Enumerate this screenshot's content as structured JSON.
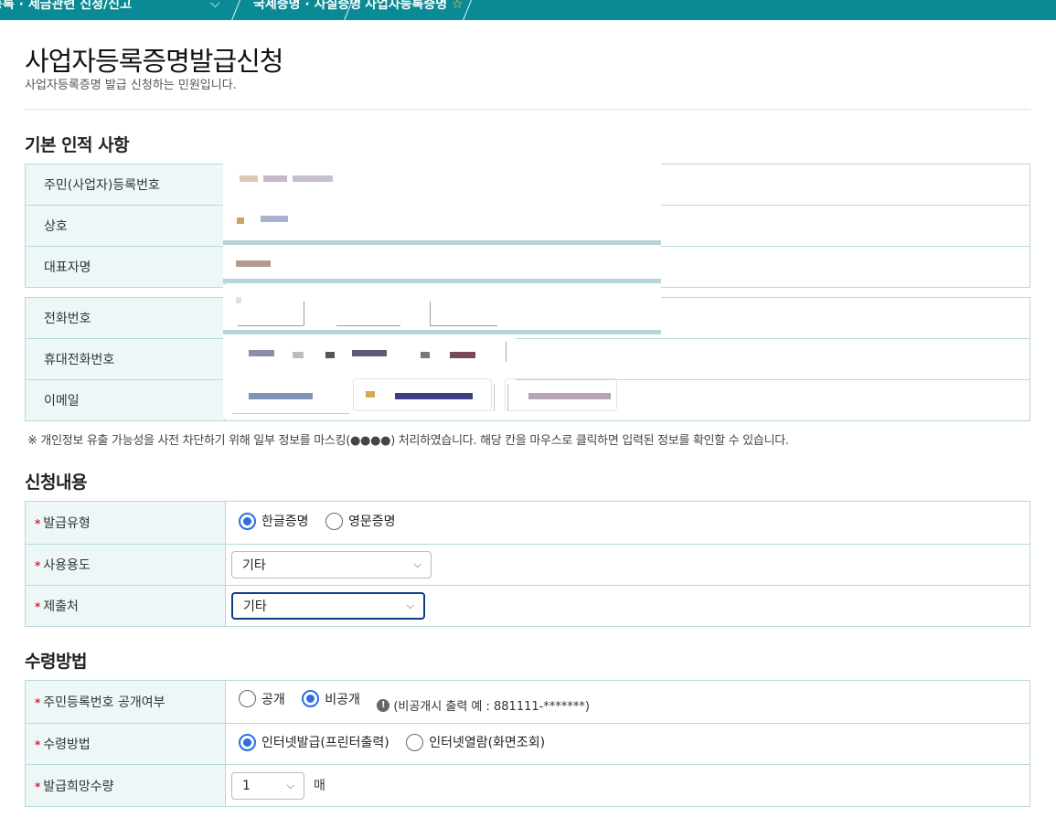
{
  "breadcrumb": {
    "item1": "등록 · 세금관련 신청/신고",
    "item2": "국세증명 · 사실증명",
    "item3": "사업자등록증명"
  },
  "page": {
    "title": "사업자등록증명발급신청",
    "subtitle": "사업자등록증명 발급 신청하는 민원입니다."
  },
  "basic_info": {
    "heading": "기본 인적 사항",
    "rows": [
      {
        "label": "주민(사업자)등록번호"
      },
      {
        "label": "상호"
      },
      {
        "label": "대표자명"
      }
    ],
    "contact_rows": [
      {
        "label": "전화번호"
      },
      {
        "label": "휴대전화번호"
      },
      {
        "label": "이메일"
      }
    ],
    "masking_notice": "※ 개인정보 유출 가능성을 사전 차단하기 위해 일부 정보를 마스킹(●●●●) 처리하였습니다. 해당 칸을 마우스로 클릭하면 입력된 정보를 확인할 수 있습니다."
  },
  "application": {
    "heading": "신청내용",
    "issue_type": {
      "label": "발급유형",
      "options": [
        "한글증명",
        "영문증명"
      ],
      "selected": "한글증명"
    },
    "purpose": {
      "label": "사용용도",
      "value": "기타"
    },
    "submit_to": {
      "label": "제출처",
      "value": "기타"
    }
  },
  "receipt": {
    "heading": "수령방법",
    "id_disclosure": {
      "label": "주민등록번호 공개여부",
      "options": [
        "공개",
        "비공개"
      ],
      "selected": "비공개",
      "help": "(비공개시 출력 예 : 881111-*******)"
    },
    "method": {
      "label": "수령방법",
      "options": [
        "인터넷발급(프린터출력)",
        "인터넷열람(화면조회)"
      ],
      "selected": "인터넷발급(프린터출력)"
    },
    "copies": {
      "label": "발급희망수량",
      "value": "1",
      "unit": "매"
    }
  },
  "colors": {
    "nav": "#0a8a94",
    "border": "#b8d8dc",
    "header_cell": "#eef7f7",
    "radio_accent": "#2b6fe0",
    "required": "#d8243a"
  },
  "icons": [
    "chevron-down-icon",
    "star-icon",
    "info-icon"
  ]
}
